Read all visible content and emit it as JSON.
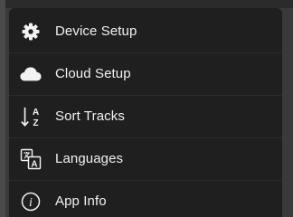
{
  "menu": {
    "items": [
      {
        "label": "Device Setup",
        "icon": "gear-icon"
      },
      {
        "label": "Cloud Setup",
        "icon": "cloud-icon"
      },
      {
        "label": "Sort Tracks",
        "icon": "sort-az-icon"
      },
      {
        "label": "Languages",
        "icon": "translate-icon"
      },
      {
        "label": "App Info",
        "icon": "info-icon"
      }
    ]
  },
  "colors": {
    "menu_background": "#1f1f1f",
    "text": "#f2f2f2",
    "backdrop": "#3a3a3a"
  }
}
